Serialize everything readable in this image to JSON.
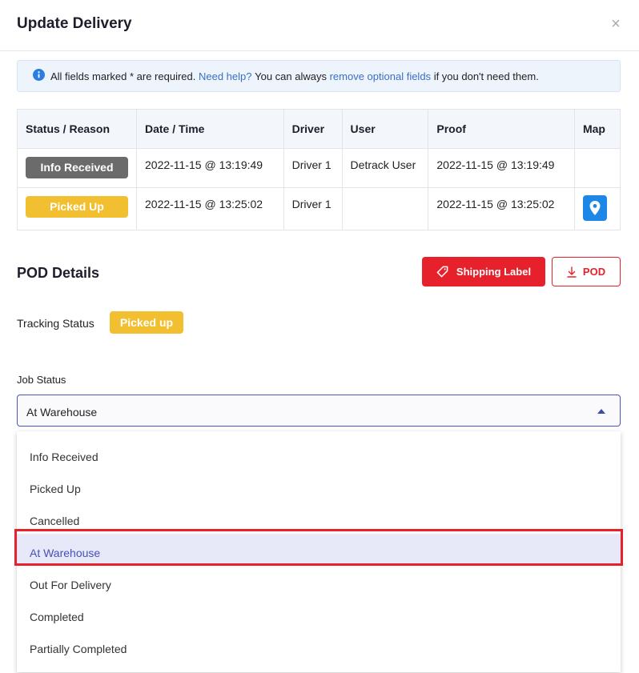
{
  "modal": {
    "title": "Update Delivery",
    "close_label": "×"
  },
  "alert": {
    "text_1": "All fields marked * are required.",
    "link_1": "Need help?",
    "text_2": "You can always",
    "link_2": "remove optional fields",
    "text_3": "if you don't need them."
  },
  "table": {
    "headers": [
      "Status / Reason",
      "Date / Time",
      "Driver",
      "User",
      "Proof",
      "Map"
    ],
    "rows": [
      {
        "status": "Info Received",
        "datetime": "2022-11-15 @ 13:19:49",
        "driver": "Driver 1",
        "user": "Detrack User",
        "proof": "2022-11-15 @ 13:19:49",
        "map": ""
      },
      {
        "status": "Picked Up",
        "datetime": "2022-11-15 @ 13:25:02",
        "driver": "Driver 1",
        "user": "",
        "proof": "2022-11-15 @ 13:25:02",
        "map": "map-pin-icon"
      }
    ]
  },
  "pod": {
    "title": "POD Details",
    "shipping_label_button": "Shipping Label",
    "pod_button": "POD"
  },
  "tracking": {
    "label": "Tracking Status",
    "value": "Picked up"
  },
  "job_status": {
    "label": "Job Status",
    "selected": "At Warehouse",
    "options": [
      "Info Received",
      "Picked Up",
      "Cancelled",
      "At Warehouse",
      "Out For Delivery",
      "Completed",
      "Partially Completed"
    ]
  },
  "colors": {
    "accent": "#4450b9",
    "danger": "#e7212b",
    "warning": "#f1bf2f",
    "neutral_badge": "#6b6b6b",
    "link": "#3a6fc9",
    "map_button": "#1c87e6"
  },
  "icons": [
    "close-icon",
    "info-icon",
    "map-pin-icon",
    "tag-icon",
    "download-icon",
    "caret-up-icon"
  ]
}
